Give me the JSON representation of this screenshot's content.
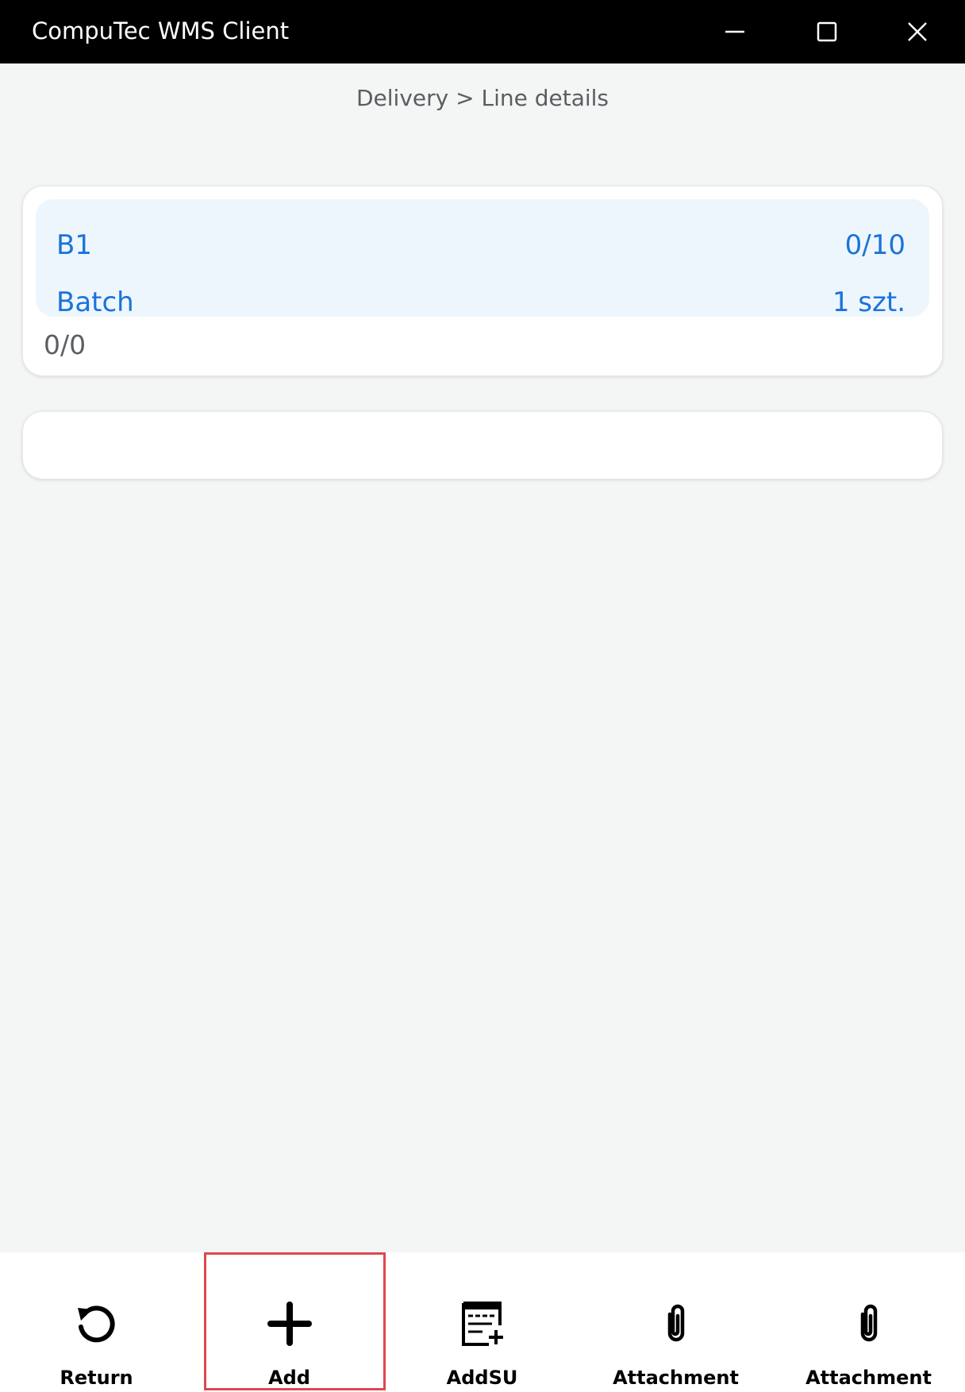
{
  "window": {
    "title": "CompuTec WMS Client",
    "minimize_icon": "minimize-icon",
    "maximize_icon": "maximize-icon",
    "close_icon": "close-icon"
  },
  "breadcrumb": "Delivery > Line details",
  "line": {
    "item_code": "B1",
    "quantity": "0/10",
    "management_type": "Batch",
    "unit": "1 szt.",
    "batch_count": "0/0"
  },
  "toolbar": {
    "items": [
      {
        "label": "Return",
        "icon": "return-icon"
      },
      {
        "label": "Add",
        "icon": "add-icon",
        "highlighted": true
      },
      {
        "label": "AddSU",
        "icon": "add-su-icon"
      },
      {
        "label": "Attachment",
        "icon": "attachment-icon"
      },
      {
        "label": "Attachment",
        "icon": "attachment-icon"
      }
    ]
  },
  "colors": {
    "accent": "#1a73d9",
    "highlight_bg": "#eef6fd",
    "focus_border": "#e0464f",
    "titlebar": "#000000"
  }
}
